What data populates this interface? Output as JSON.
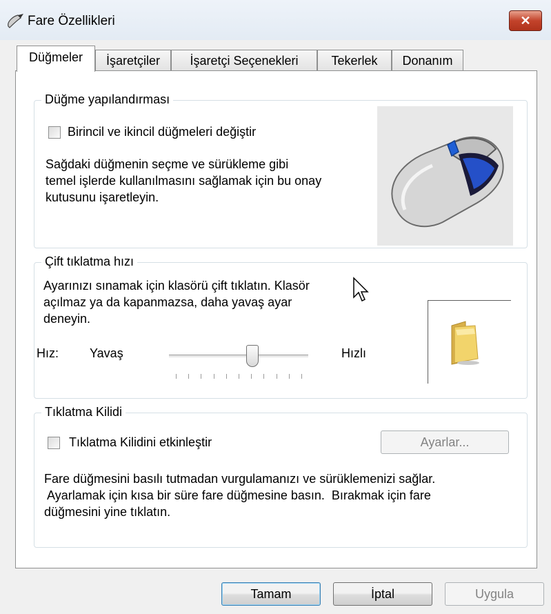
{
  "window": {
    "title": "Fare Özellikleri",
    "close_icon": "close-icon"
  },
  "tabs": [
    {
      "label": "Düğmeler",
      "active": true
    },
    {
      "label": "İşaretçiler",
      "active": false
    },
    {
      "label": "İşaretçi Seçenekleri",
      "active": false
    },
    {
      "label": "Tekerlek",
      "active": false
    },
    {
      "label": "Donanım",
      "active": false
    }
  ],
  "button_config": {
    "legend": "Düğme yapılandırması",
    "checkbox_label": "Birincil ve ikincil düğmeleri değiştir",
    "checked": false,
    "description": [
      "Sağdaki düğmenin seçme ve sürükleme gibi",
      "temel işlerde kullanılmasını sağlamak için bu onay",
      "kutusunu işaretleyin."
    ]
  },
  "double_click": {
    "legend": "Çift tıklatma hızı",
    "description": [
      "Ayarınızı sınamak için klasörü çift tıklatın. Klasör",
      "açılmaz ya da kapanmazsa, daha yavaş ayar",
      "deneyin."
    ],
    "speed_label": "Hız:",
    "slow_label": "Yavaş",
    "fast_label": "Hızlı",
    "slider_value_fraction": 0.6,
    "tick_count": 11
  },
  "click_lock": {
    "legend": "Tıklatma Kilidi",
    "checkbox_label": "Tıklatma Kilidini etkinleştir",
    "checked": false,
    "settings_button": "Ayarlar...",
    "description": [
      "Fare düğmesini basılı tutmadan vurgulamanızı ve sürüklemenizi sağlar.",
      " Ayarlamak için kısa bir süre fare düğmesine basın.  Bırakmak için fare",
      "düğmesini yine tıklatın."
    ]
  },
  "footer": {
    "ok": "Tamam",
    "cancel": "İptal",
    "apply": "Uygula"
  },
  "colors": {
    "mouse_accent": "#1f5fd6",
    "folder": "#f2d46b"
  }
}
